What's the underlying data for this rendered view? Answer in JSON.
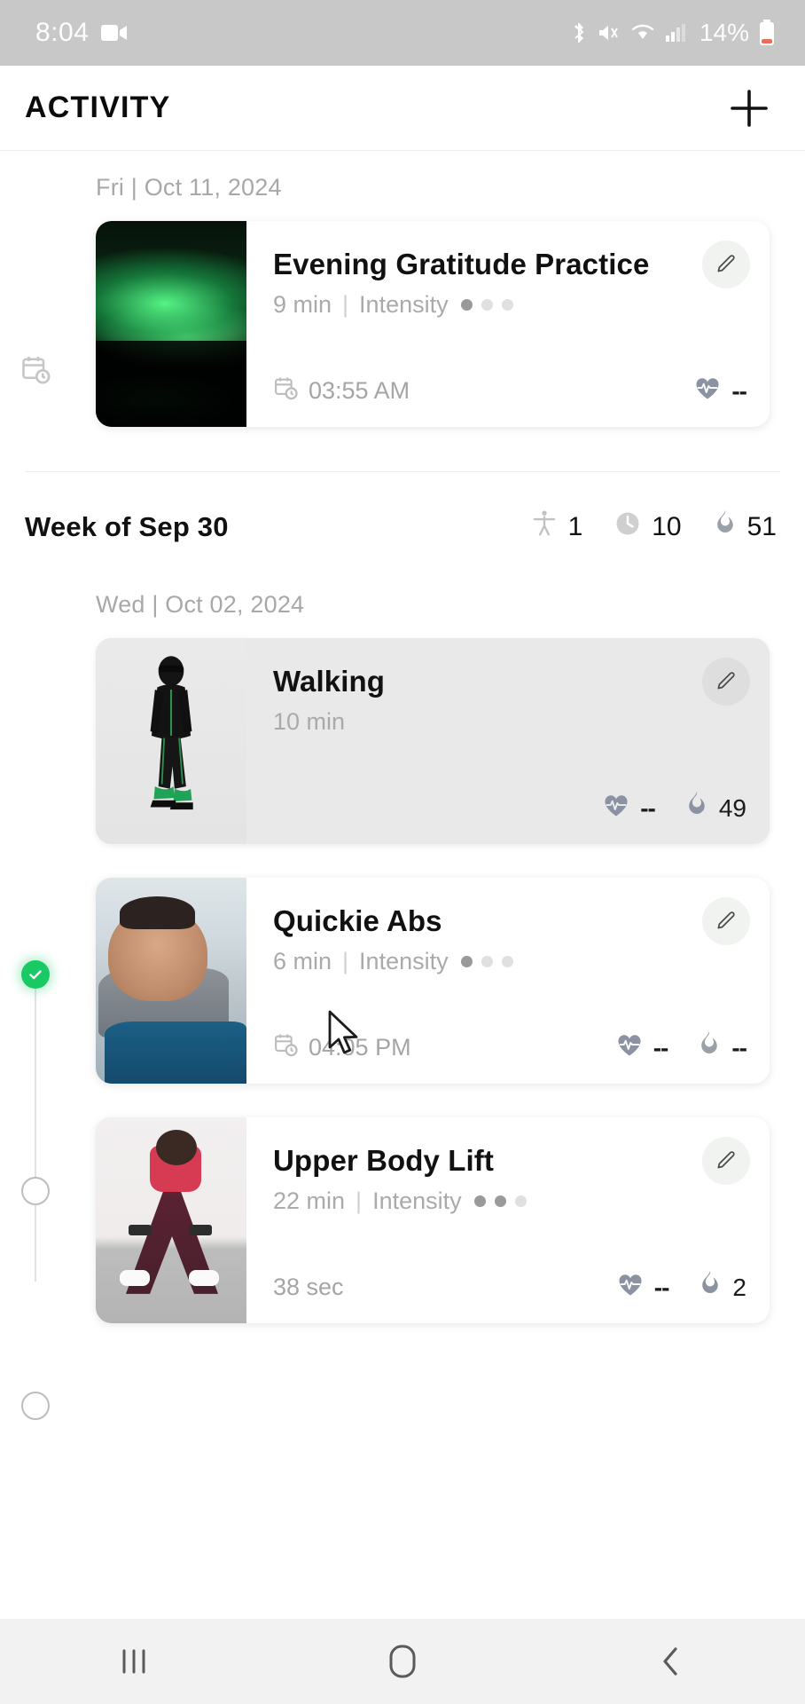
{
  "status_bar": {
    "time": "8:04",
    "battery_percent": "14%",
    "icons": [
      "screen-record-icon",
      "bluetooth-icon",
      "mute-icon",
      "wifi-icon",
      "cellular-signal-icon",
      "battery-icon"
    ]
  },
  "app_bar": {
    "title": "ACTIVITY",
    "add_button": "+"
  },
  "sections": [
    {
      "date_label": "Fri | Oct 11, 2024",
      "rail_marker": "calendar-clock-icon",
      "cards": [
        {
          "title": "Evening Gratitude Practice",
          "duration": "9 min",
          "separator": "|",
          "intensity_label": "Intensity",
          "intensity_level": 1,
          "intensity_total": 3,
          "foot_icon": "calendar-clock-icon",
          "foot_text": "03:55 AM",
          "heart_rate": "--",
          "calories": null,
          "selected": false,
          "thumb": "aurora-borealis-photo",
          "edit_button": "edit-pencil-icon"
        }
      ]
    }
  ],
  "week_summary": {
    "title": "Week of Sep 30",
    "stats": [
      {
        "icon": "activity-person-icon",
        "value": "1"
      },
      {
        "icon": "clock-icon",
        "value": "10"
      },
      {
        "icon": "flame-icon",
        "value": "51"
      }
    ]
  },
  "week_sections": [
    {
      "date_label": "Wed | Oct 02, 2024",
      "cards": [
        {
          "title": "Walking",
          "duration": "10 min",
          "separator": "",
          "intensity_label": "",
          "intensity_level": 0,
          "intensity_total": 0,
          "foot_icon": "",
          "foot_text": "",
          "heart_rate": "--",
          "calories": "49",
          "selected": true,
          "rail_marker": "checked-circle",
          "thumb": "walking-person-photo",
          "edit_button": "edit-pencil-icon"
        },
        {
          "title": "Quickie Abs",
          "duration": "6 min",
          "separator": "|",
          "intensity_label": "Intensity",
          "intensity_level": 1,
          "intensity_total": 3,
          "foot_icon": "calendar-clock-icon",
          "foot_text": "04:05 PM",
          "heart_rate": "--",
          "calories": "--",
          "selected": false,
          "rail_marker": "empty-circle",
          "thumb": "abs-workout-photo",
          "edit_button": "edit-pencil-icon"
        },
        {
          "title": "Upper Body Lift",
          "duration": "22 min",
          "separator": "|",
          "intensity_label": "Intensity",
          "intensity_level": 2,
          "intensity_total": 3,
          "foot_icon": "",
          "foot_text": "38 sec",
          "heart_rate": "--",
          "calories": "2",
          "selected": false,
          "rail_marker": "empty-circle",
          "thumb": "dumbbell-squat-photo",
          "edit_button": "edit-pencil-icon"
        }
      ]
    }
  ],
  "nav_bar": {
    "recents_label": "recents-icon",
    "home_label": "home-icon",
    "back_label": "back-icon"
  },
  "colors": {
    "accent_green": "#18c964",
    "status_bar_bg": "#c8c8c8",
    "card_selected_bg": "#e9e9e9",
    "muted_text": "#a8a8a8",
    "battery_low": "#e8705a"
  }
}
